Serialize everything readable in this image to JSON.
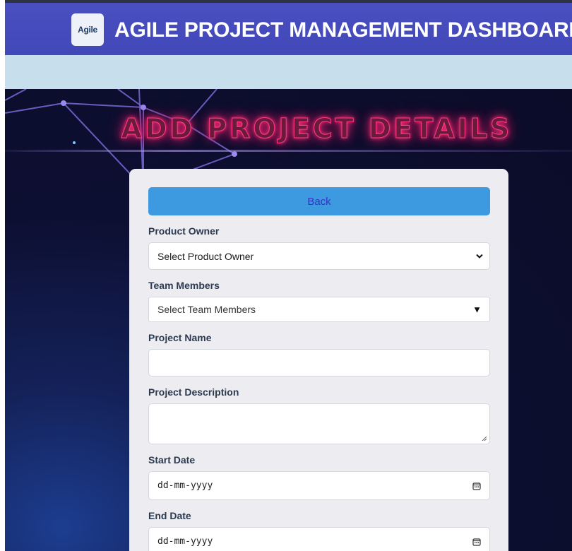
{
  "header": {
    "logo_text": "Agile",
    "title": "AGILE PROJECT MANAGEMENT DASHBOARD"
  },
  "hero": {
    "title": "ADD PROJECT DETAILS"
  },
  "form": {
    "back_label": "Back",
    "product_owner": {
      "label": "Product Owner",
      "selected": "Select Product Owner"
    },
    "team_members": {
      "label": "Team Members",
      "selected": "Select Team Members"
    },
    "project_name": {
      "label": "Project Name",
      "value": ""
    },
    "project_description": {
      "label": "Project Description",
      "value": ""
    },
    "start_date": {
      "label": "Start Date",
      "placeholder": "dd-mm-yyyy"
    },
    "end_date": {
      "label": "End Date",
      "placeholder": "dd-mm-yyyy"
    }
  },
  "colors": {
    "header_bg": "#4148b8",
    "subbar_bg": "#c7dfec",
    "button_bg": "#3d9ae0",
    "neon_title": "#ff2f7a"
  },
  "icons": [
    "chevron-down-icon",
    "triangle-down-icon",
    "calendar-icon",
    "resize-handle-icon"
  ]
}
